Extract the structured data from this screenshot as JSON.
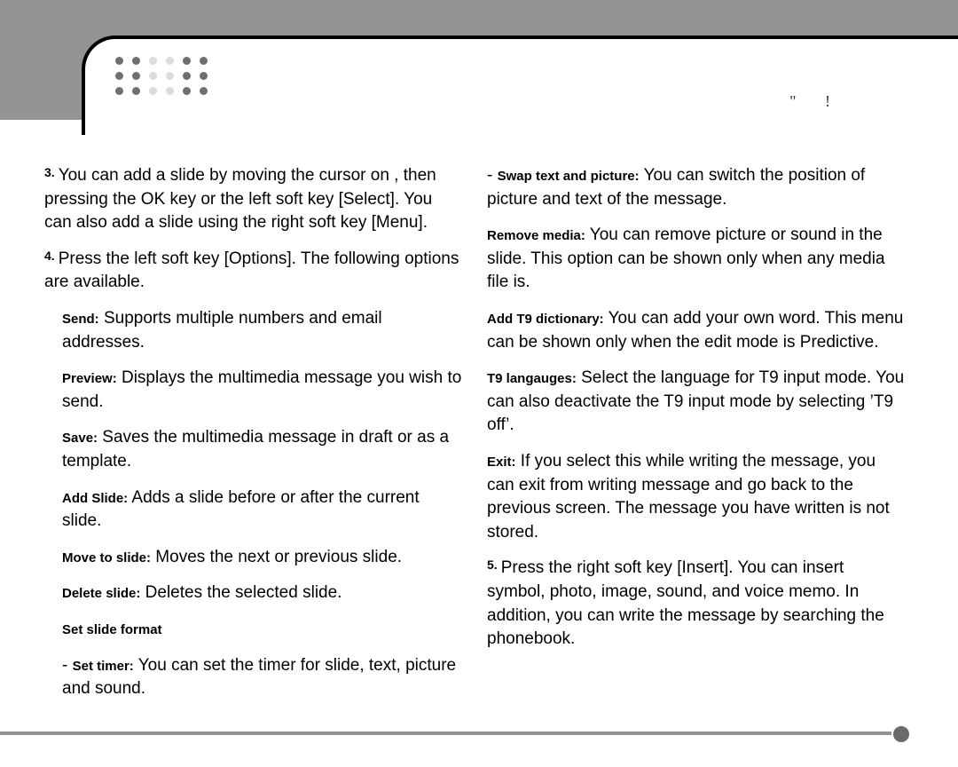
{
  "header_mark": "\"   !",
  "left": {
    "step3_num": "3.",
    "step3": "You can add a slide by moving the cursor on       , then pressing the OK key or the left soft key [Select]. You can also add a slide using the right soft key [Menu].",
    "step4_num": "4.",
    "step4": "Press the left soft key [Options]. The following options are available.",
    "opts": {
      "send_b": "Send:",
      "send": " Supports multiple numbers and email addresses.",
      "preview_b": "Preview:",
      "preview": " Displays the multimedia message you wish to send.",
      "save_b": "Save:",
      "save": " Saves the multimedia message in draft or as a template.",
      "addslide_b": "Add Slide:",
      "addslide": " Adds a slide before or after the current slide.",
      "moveto_b": "Move to slide:",
      "moveto": " Moves the next or previous slide.",
      "delete_b": "Delete slide:",
      "delete": " Deletes the selected slide.",
      "setformat_b": "Set slide format",
      "settimer_pre": "- ",
      "settimer_b": "Set timer:",
      "settimer": " You can set the timer for slide, text, picture and sound."
    }
  },
  "right": {
    "swap_pre": "- ",
    "swap_b": "Swap text and picture:",
    "swap": " You can switch the position of picture and text of the message.",
    "remove_b": "Remove media:",
    "remove": " You can remove picture or sound in the slide. This option can be shown only when any media file is.",
    "addt9_b": "Add T9 dictionary:",
    "addt9": " You can add your own word. This menu can be shown only when the edit mode is Predictive.",
    "t9lang_b": "T9 langauges:",
    "t9lang": " Select the language for T9 input mode. You can also deactivate the T9 input mode by selecting ’T9 off’.",
    "exit_b": "Exit:",
    "exit": " If you select this while writing the message, you can exit from writing message and go back to the previous screen. The message you have written is not stored.",
    "step5_num": "5.",
    "step5": "Press the right soft key [Insert]. You can insert symbol, photo, image, sound, and voice memo. In addition, you can write the message by searching the phonebook."
  }
}
